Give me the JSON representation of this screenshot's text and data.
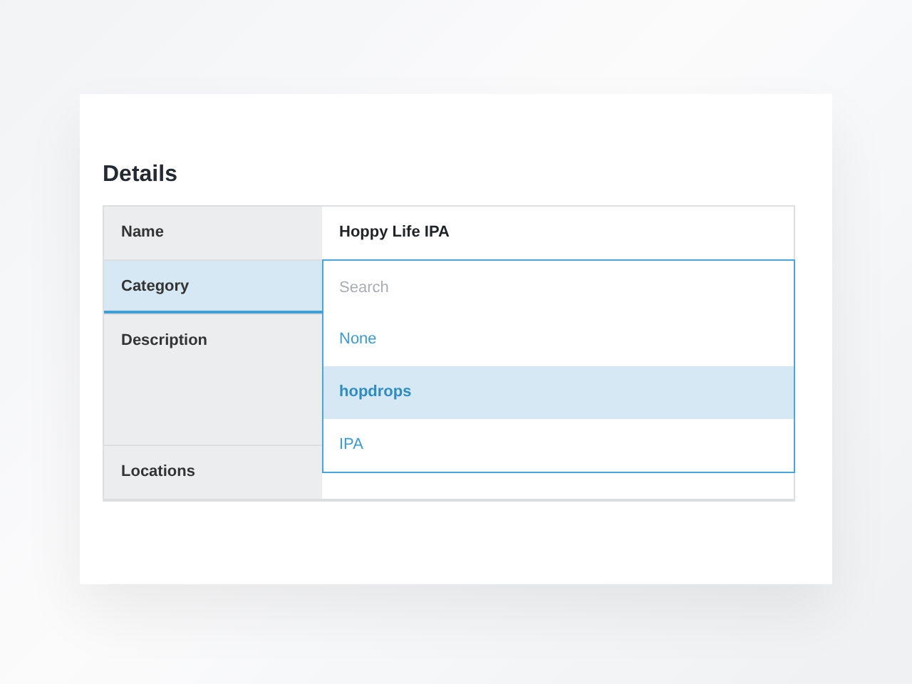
{
  "title": "Details",
  "rows": [
    {
      "label": "Name",
      "value": "Hoppy Life IPA",
      "kind": "text",
      "selected": false
    },
    {
      "label": "Category",
      "kind": "select",
      "selected": true
    },
    {
      "label": "Description",
      "kind": "textarea",
      "selected": false
    },
    {
      "label": "Locations",
      "kind": "covered",
      "selected": false
    }
  ],
  "dropdown": {
    "search": {
      "placeholder": "Search"
    },
    "options": [
      {
        "label": "None",
        "selected": false
      },
      {
        "label": "hopdrops",
        "selected": true
      },
      {
        "label": "IPA",
        "selected": false
      }
    ]
  }
}
